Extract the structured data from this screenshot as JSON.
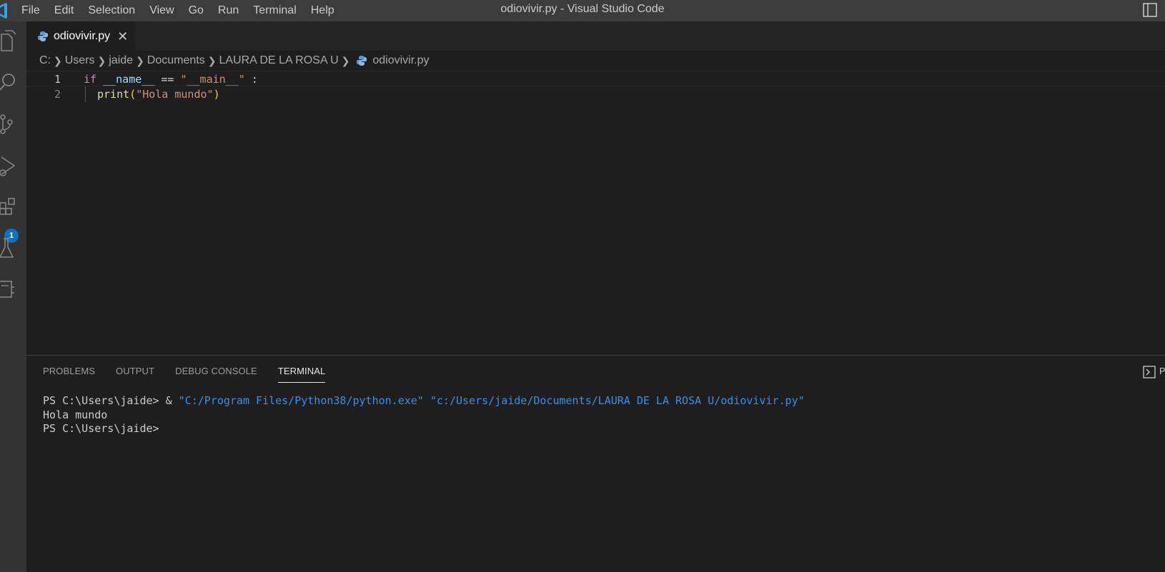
{
  "menu": {
    "items": [
      "File",
      "Edit",
      "Selection",
      "View",
      "Go",
      "Run",
      "Terminal",
      "Help"
    ]
  },
  "window": {
    "title": "odiovivir.py - Visual Studio Code"
  },
  "activity_bar": {
    "icons": [
      "files-icon",
      "search-icon",
      "source-control-icon",
      "run-debug-icon",
      "extensions-icon",
      "testing-icon",
      "remote-explorer-icon"
    ],
    "extensions_badge": "1"
  },
  "tabs": [
    {
      "label": "odiovivir.py",
      "close": "✕"
    }
  ],
  "breadcrumbs": [
    "C:",
    "Users",
    "jaide",
    "Documents",
    "LAURA DE LA ROSA U",
    "odiovivir.py"
  ],
  "editor": {
    "lines": [
      {
        "number": "1"
      },
      {
        "number": "2"
      }
    ],
    "code": {
      "l1_if": "if",
      "l1_name": "__name__",
      "l1_eq": " == ",
      "l1_str": "\"__main__\"",
      "l1_colon": " :",
      "l2_fn": "print",
      "l2_open": "(",
      "l2_str": "\"Hola mundo\"",
      "l2_close": ")"
    }
  },
  "panel": {
    "tabs": [
      "PROBLEMS",
      "OUTPUT",
      "DEBUG CONSOLE",
      "TERMINAL"
    ],
    "active_tab": "TERMINAL",
    "action_label": "P"
  },
  "terminal": {
    "line1_prompt": "PS C:\\Users\\jaide> ",
    "line1_amp": "& ",
    "line1_exe": "\"C:/Program Files/Python38/python.exe\"",
    "line1_space": " ",
    "line1_script": "\"c:/Users/jaide/Documents/LAURA DE LA ROSA U/odiovivir.py\"",
    "line2": "Hola mundo",
    "line3": "PS C:\\Users\\jaide>"
  },
  "colors": {
    "accent": "#0e70c0",
    "keyword": "#c586c0",
    "string": "#ce9178",
    "function": "#dcdcaa",
    "variable": "#9cdcfe",
    "terminal_path": "#3b8eea"
  }
}
